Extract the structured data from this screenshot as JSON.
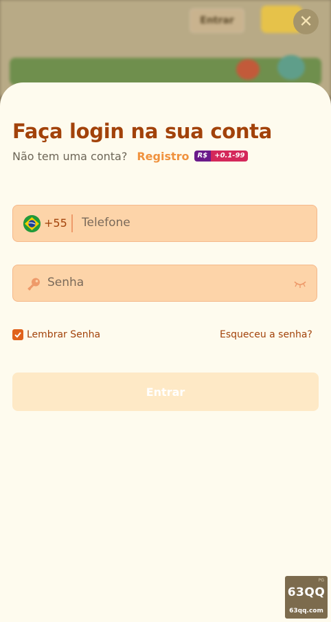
{
  "background_app": {
    "header_button_label": "Entrar"
  },
  "close_button": {
    "icon": "close-icon",
    "label": "✕"
  },
  "login": {
    "title": "Faça login na sua conta",
    "no_account_text": "Não tem uma conta?",
    "register_link": "Registro",
    "register_badge": {
      "currency": "R$",
      "amount": "+0.1-99"
    },
    "phone": {
      "country_flag_icon": "brazil-flag-icon",
      "country_code": "+55",
      "placeholder": "Telefone",
      "value": ""
    },
    "password": {
      "icon": "key-icon",
      "placeholder": "Senha",
      "value": "",
      "visibility_icon": "eye-closed-icon"
    },
    "remember": {
      "label": "Lembrar Senha",
      "checked": true
    },
    "forgot_link": "Esqueceu a senha?",
    "submit_label": "Entrar"
  },
  "watermark": {
    "tag": "PG",
    "brand": "63QQ",
    "url": "63qq.com"
  },
  "colors": {
    "accent": "#a2420a",
    "link": "#f0923e",
    "field_bg": "#fdd4a9",
    "sheet_bg": "#fefbee",
    "checkbox": "#e0621c",
    "submit_bg": "#fee9c6"
  }
}
